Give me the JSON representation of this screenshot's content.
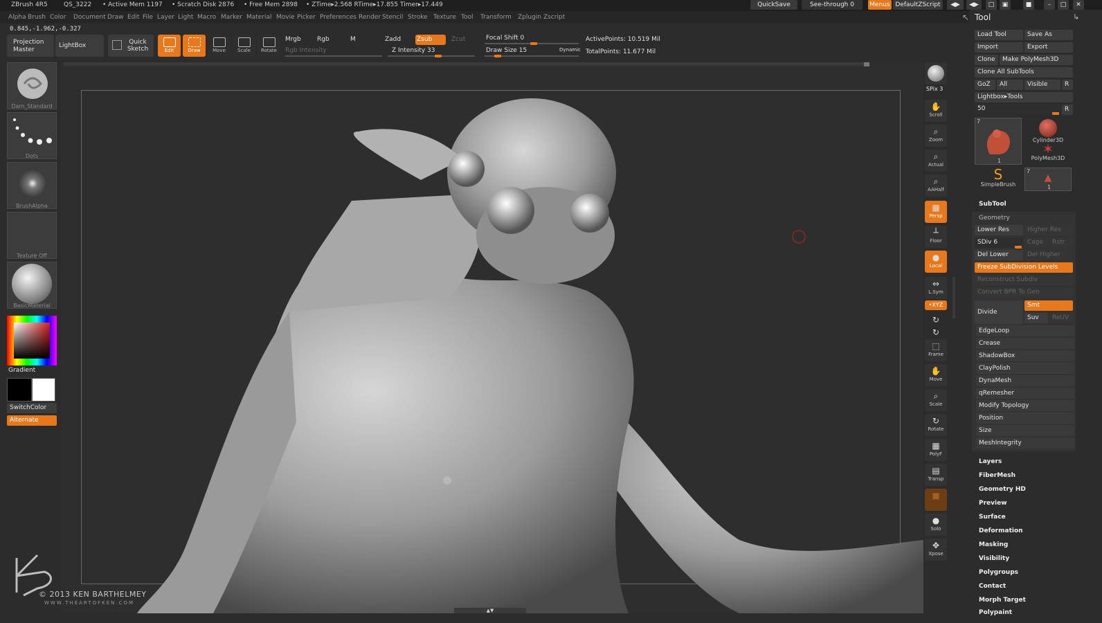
{
  "status": {
    "app": "ZBrush 4R5",
    "qs": "QS_3222",
    "active_mem": "• Active Mem 1197",
    "scratch": "• Scratch Disk 2876",
    "free_mem": "• Free Mem 2898",
    "ztime": "• ZTime▸2.568 RTime▸17.855 Timer▸17.449"
  },
  "topright": {
    "quicksave": "QuickSave",
    "seethrough": "See-through",
    "seethrough_val": "0",
    "menus": "Menus",
    "script": "DefaultZScript"
  },
  "menus": [
    "Alpha",
    "Brush",
    "Color",
    "Document",
    "Draw",
    "Edit",
    "File",
    "Layer",
    "Light",
    "Macro",
    "Marker",
    "Material",
    "Movie",
    "Picker",
    "Preferences",
    "Render",
    "Stencil",
    "Stroke",
    "Texture",
    "Tool",
    "Transform",
    "Zplugin",
    "Zscript"
  ],
  "coords": "0.845,-1.962,-0.327",
  "toolbar": {
    "projection_master": "Projection Master",
    "lightbox": "LightBox",
    "quick_sketch": "Quick Sketch",
    "edit": "Edit",
    "draw": "Draw",
    "move": "Move",
    "scale": "Scale",
    "rotate": "Rotate",
    "mrgb": "Mrgb",
    "rgb": "Rgb",
    "m": "M",
    "rgb_intensity": "Rgb Intensity",
    "zadd": "Zadd",
    "zsub": "Zsub",
    "zcut": "Zcut",
    "z_intensity": "Z Intensity 33",
    "focal_shift": "Focal Shift 0",
    "draw_size": "Draw Size 15",
    "dynamic": "Dynamic",
    "active_points": "ActivePoints: 10.519 Mil",
    "total_points": "TotalPoints: 11.677 Mil"
  },
  "left": {
    "brush": "Dam_Standard",
    "stroke": "Dots",
    "alpha": "BrushAlpha",
    "texture": "Texture Off",
    "material": "BasicMaterial",
    "gradient": "Gradient",
    "switchcolor": "SwitchColor",
    "alternate": "Alternate"
  },
  "canvas": {
    "copyright": "© 2013 KEN BARTHELMEY",
    "website": "WWW.THEARTOFKEN.COM"
  },
  "rshelf": {
    "bpr": "BPR",
    "spix": "SPix 3",
    "scroll": "Scroll",
    "zoom": "Zoom",
    "actual": "Actual",
    "aahalf": "AAHalf",
    "persp": "Persp",
    "floor": "Floor",
    "local": "Local",
    "lsym": "L.Sym",
    "xyz": "•XYZ",
    "frame": "Frame",
    "move": "Move",
    "scale": "Scale",
    "rotate": "Rotate",
    "polyf": "PolyF",
    "transp": "Transp",
    "solo": "Solo",
    "xpose": "Xpose"
  },
  "tool": {
    "title": "Tool",
    "load_tool": "Load Tool",
    "save_as": "Save As",
    "import": "Import",
    "export": "Export",
    "clone": "Clone",
    "make_polymesh": "Make PolyMesh3D",
    "clone_all": "Clone All SubTools",
    "goz": "GoZ",
    "all": "All",
    "visible": "Visible",
    "r": "R",
    "lightbox_tools": "Lightbox▸Tools",
    "size_val": "50",
    "thumb1_count": "7",
    "thumb1_num": "1",
    "cylinder": "Cylinder3D",
    "polymesh": "PolyMesh3D",
    "simplebrush": "SimpleBrush",
    "thumb4_count": "7",
    "thumb4_num": "1",
    "subtool": "SubTool",
    "geometry": "Geometry",
    "lower_res": "Lower Res",
    "higher_res": "Higher Res",
    "sdiv": "SDiv 6",
    "cage": "Cage",
    "rstr": "Rstr",
    "del_lower": "Del Lower",
    "del_higher": "Del Higher",
    "freeze": "Freeze SubDivision Levels",
    "reconstruct": "Reconstruct Subdiv",
    "convert_bpr": "Convert BPR To Geo",
    "divide": "Divide",
    "smt": "Smt",
    "suv": "Suv",
    "reuv": "ReUV",
    "geo_items": [
      "EdgeLoop",
      "Crease",
      "ShadowBox",
      "ClayPolish",
      "DynaMesh",
      "qRemesher",
      "Modify Topology",
      "Position",
      "Size",
      "MeshIntegrity"
    ],
    "sections": [
      "Layers",
      "FiberMesh",
      "Geometry HD",
      "Preview",
      "Surface",
      "Deformation",
      "Masking",
      "Visibility",
      "Polygroups",
      "Contact",
      "Morph Target",
      "Polypaint"
    ]
  },
  "colors": {
    "accent": "#e8781c",
    "bg": "#2c2c2c"
  }
}
